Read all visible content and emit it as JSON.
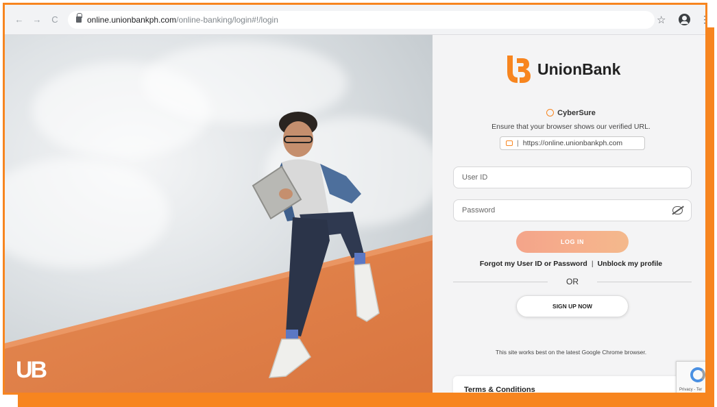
{
  "browser": {
    "url_host": "online.unionbankph.com",
    "url_path": "/online-banking/login#!/login",
    "back_icon": "arrow-left-icon",
    "forward_icon": "arrow-right-icon",
    "reload_icon": "reload-icon",
    "back_glyph": "←",
    "forward_glyph": "→",
    "reload_glyph": "C",
    "star_glyph": "☆",
    "more_glyph": "⋮"
  },
  "hero": {
    "logo_text": "UB"
  },
  "brand": {
    "name": "UnionBank",
    "accent_color": "#f7851f"
  },
  "cybersure": {
    "title": "CyberSure",
    "message": "Ensure that your browser shows our verified URL.",
    "sep": "|",
    "verified_url": "https://online.unionbankph.com"
  },
  "login_form": {
    "user_id_placeholder": "User ID",
    "password_placeholder": "Password",
    "login_label": "LOG IN",
    "forgot_label": "Forgot my User ID or Password",
    "separator": "|",
    "unblock_label": "Unblock my profile",
    "or_label": "OR",
    "signup_label": "SIGN UP NOW"
  },
  "footer": {
    "browser_note": "This site works best on the latest Google Chrome browser.",
    "terms_label": "Terms & Conditions",
    "terms_chevron": "›",
    "recaptcha_text": "Privacy - Ter"
  }
}
